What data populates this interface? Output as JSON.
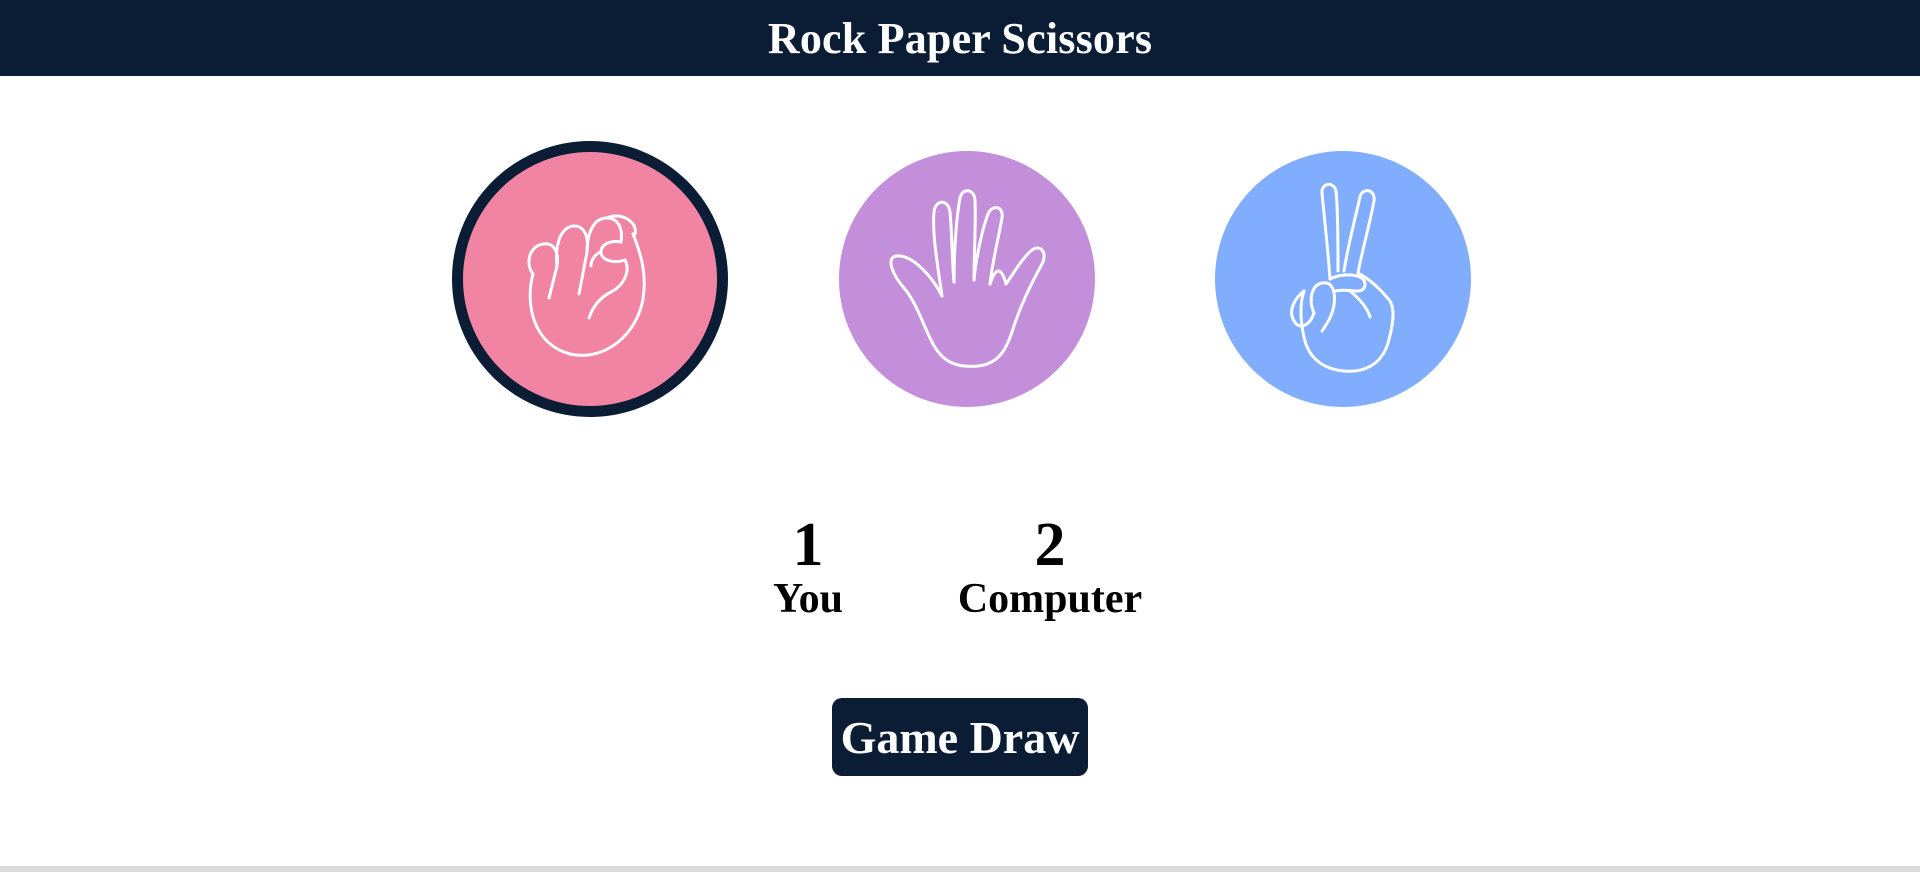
{
  "header": {
    "title": "Rock Paper Scissors"
  },
  "choices": [
    {
      "id": "rock",
      "icon": "fist-icon",
      "color": "#f084a2",
      "selected": true
    },
    {
      "id": "paper",
      "icon": "open-hand-icon",
      "color": "#c38fdb",
      "selected": false
    },
    {
      "id": "scissors",
      "icon": "peace-hand-icon",
      "color": "#80adfd",
      "selected": false
    }
  ],
  "score": {
    "you": {
      "value": "1",
      "label": "You"
    },
    "computer": {
      "value": "2",
      "label": "Computer"
    }
  },
  "result": {
    "label": "Game Draw"
  },
  "colors": {
    "dark": "#0b1c35",
    "background": "#ffffff"
  }
}
